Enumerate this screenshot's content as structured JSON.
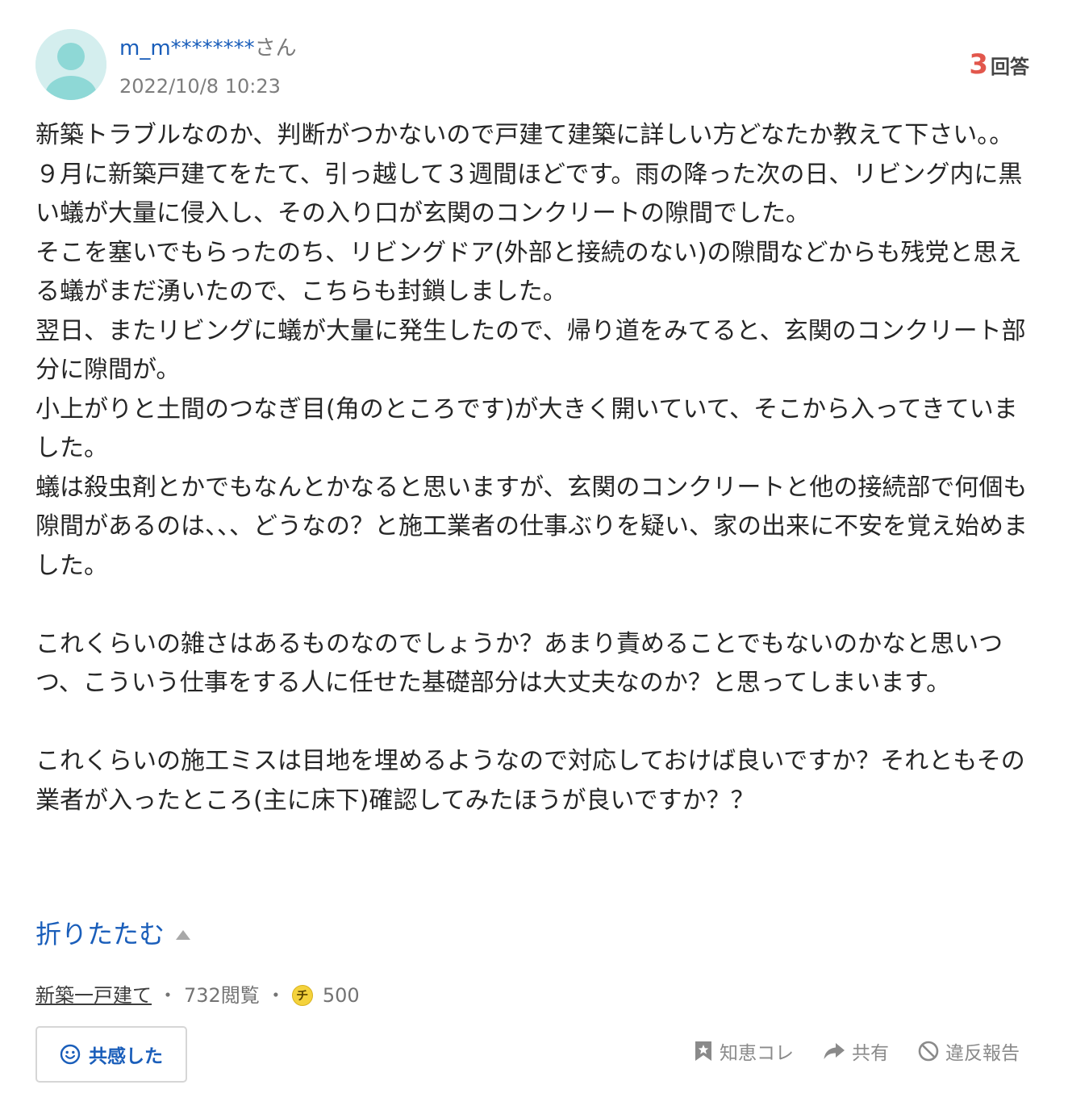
{
  "questioner": {
    "user_id": "m_m********",
    "user_suffix": "さん",
    "date": "2022/10/8 10:23"
  },
  "answer_count": {
    "number": "3",
    "label": "回答"
  },
  "question": {
    "paragraphs": [
      "新築トラブルなのか、判断がつかないので戸建て建築に詳しい方どなたか教えて下さい。。\n９月に新築戸建てをたて、引っ越して３週間ほどです。雨の降った次の日、リビング内に黒い蟻が大量に侵入し、その入り口が玄関のコンクリートの隙間でした。\nそこを塞いでもらったのち、リビングドア(外部と接続のない)の隙間などからも残党と思える蟻がまだ湧いたので、こちらも封鎖しました。\n翌日、またリビングに蟻が大量に発生したので、帰り道をみてると、玄関のコンクリート部分に隙間が。\n小上がりと土間のつなぎ目(角のところです)が大きく開いていて、そこから入ってきていました。\n蟻は殺虫剤とかでもなんとかなると思いますが、玄関のコンクリートと他の接続部で何個も隙間があるのは、、、どうなの？と施工業者の仕事ぶりを疑い、家の出来に不安を覚え始めました。\n\nこれくらいの雑さはあるものなのでしょうか？あまり責めることでもないのかなと思いつつ、こういう仕事をする人に任せた基礎部分は大丈夫なのか？と思ってしまいます。\n\nこれくらいの施工ミスは目地を埋めるようなので対応しておけば良いですか？それともその業者が入ったところ(主に床下)確認してみたほうが良いですか？？"
    ]
  },
  "collapse_label": "折りたたむ",
  "meta": {
    "category": "新築一戸建て",
    "separator": "・",
    "views": "732閲覧",
    "coin_symbol": "チ",
    "coins": "500"
  },
  "empathy_button": {
    "label": "共感した",
    "icon": "smile-icon"
  },
  "actions": [
    {
      "label": "知恵コレ",
      "icon": "bookmark-star-icon"
    },
    {
      "label": "共有",
      "icon": "share-arrow-icon"
    },
    {
      "label": "違反報告",
      "icon": "prohibited-icon"
    }
  ],
  "colors": {
    "link_blue": "#1a5eba",
    "answer_count_red": "#e2574c",
    "avatar_bg": "#d4eeee",
    "avatar_fg": "#8ed8d6"
  }
}
